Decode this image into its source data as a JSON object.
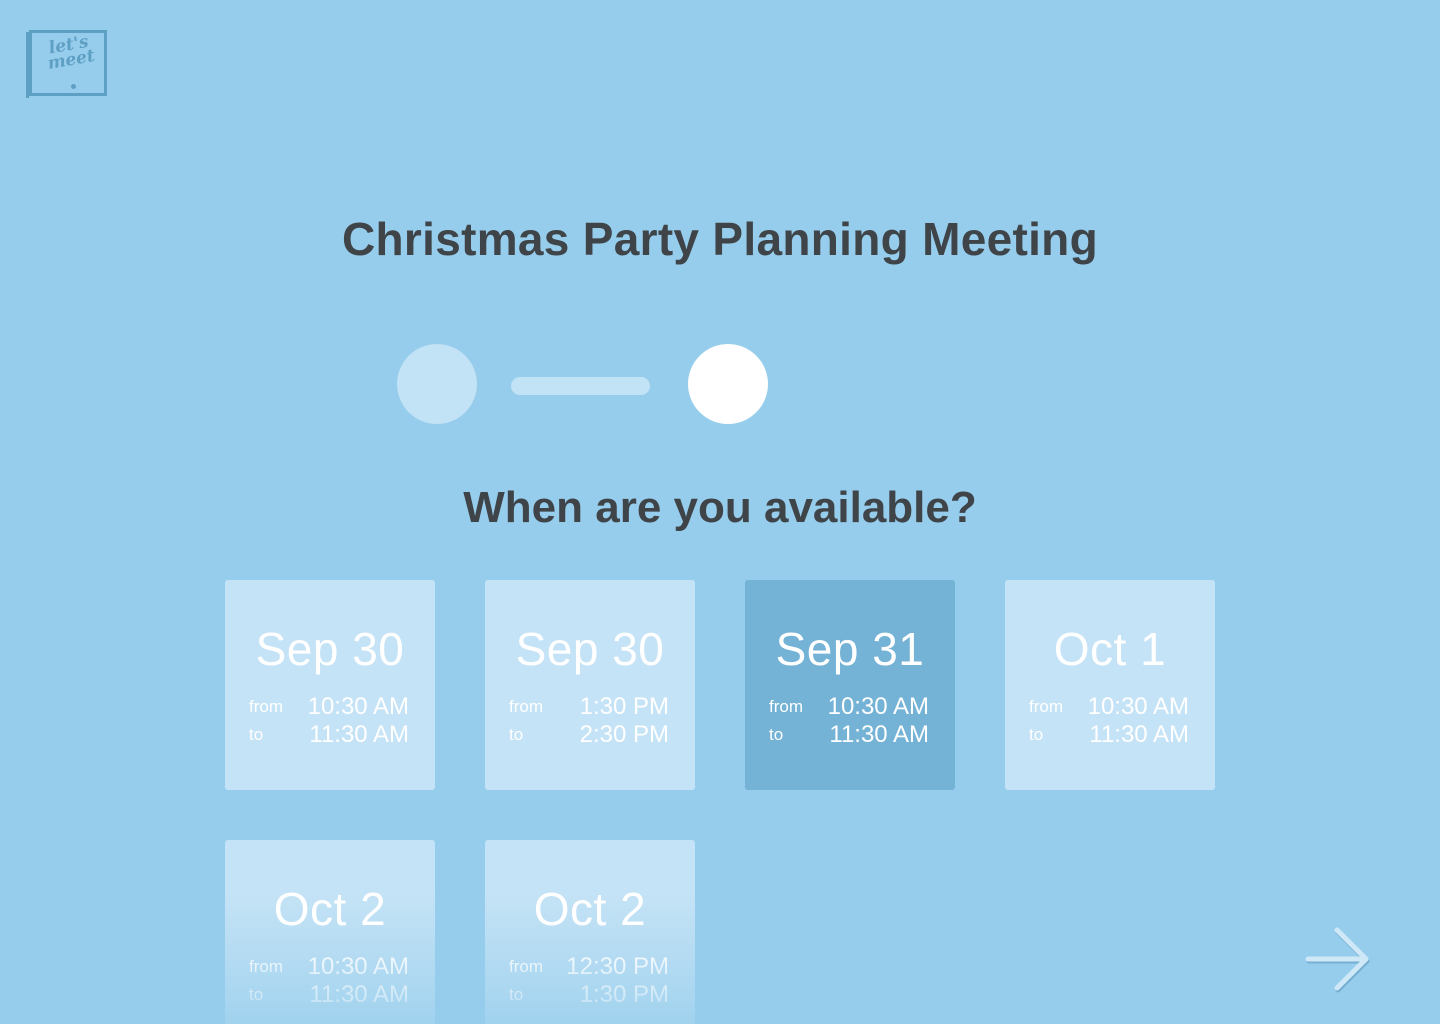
{
  "logo": {
    "text": "let's\nmeet"
  },
  "meeting": {
    "title": "Christmas Party Planning Meeting"
  },
  "progress": {
    "current_step": 2,
    "total_steps": 2
  },
  "availability": {
    "question": "When are you available?",
    "slots": [
      {
        "date": "Sep 30",
        "from_label": "from",
        "to_label": "to",
        "from": "10:30 AM",
        "to": "11:30 AM",
        "selected": false
      },
      {
        "date": "Sep 30",
        "from_label": "from",
        "to_label": "to",
        "from": "1:30 PM",
        "to": "2:30 PM",
        "selected": false
      },
      {
        "date": "Sep 31",
        "from_label": "from",
        "to_label": "to",
        "from": "10:30 AM",
        "to": "11:30 AM",
        "selected": true
      },
      {
        "date": "Oct 1",
        "from_label": "from",
        "to_label": "to",
        "from": "10:30 AM",
        "to": "11:30 AM",
        "selected": false
      },
      {
        "date": "Oct 2",
        "from_label": "from",
        "to_label": "to",
        "from": "10:30 AM",
        "to": "11:30 AM",
        "selected": false
      },
      {
        "date": "Oct 2",
        "from_label": "from",
        "to_label": "to",
        "from": "12:30 PM",
        "to": "1:30 PM",
        "selected": false
      }
    ]
  },
  "icons": {
    "next": "arrow-right-icon"
  },
  "colors": {
    "background": "#97cdec",
    "card": "#c5e3f6",
    "card_selected": "#74b2d6",
    "heading_text": "#3f4448",
    "logo": "#5e9fc4"
  }
}
